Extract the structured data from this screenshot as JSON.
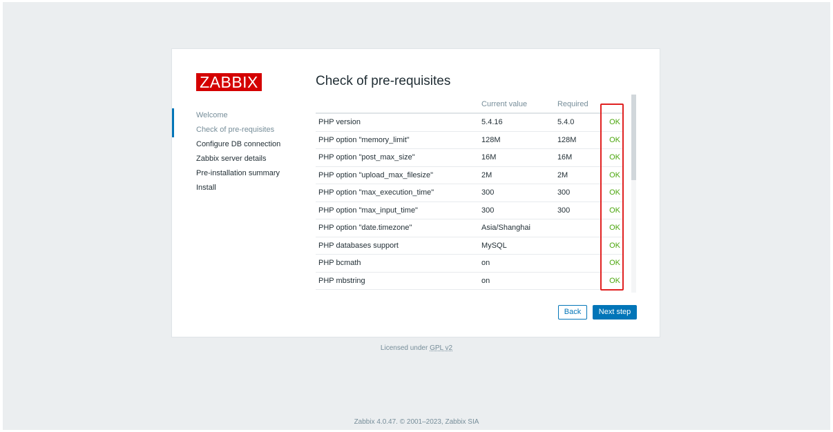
{
  "logo": "ZABBIX",
  "nav": {
    "items": [
      {
        "label": "Welcome",
        "state": "done"
      },
      {
        "label": "Check of pre-requisites",
        "state": "current"
      },
      {
        "label": "Configure DB connection",
        "state": "todo"
      },
      {
        "label": "Zabbix server details",
        "state": "todo"
      },
      {
        "label": "Pre-installation summary",
        "state": "todo"
      },
      {
        "label": "Install",
        "state": "todo"
      }
    ]
  },
  "page_title": "Check of pre-requisites",
  "table": {
    "headers": {
      "name": "",
      "current": "Current value",
      "required": "Required",
      "status": ""
    },
    "rows": [
      {
        "name": "PHP version",
        "current": "5.4.16",
        "required": "5.4.0",
        "status": "OK"
      },
      {
        "name": "PHP option \"memory_limit\"",
        "current": "128M",
        "required": "128M",
        "status": "OK"
      },
      {
        "name": "PHP option \"post_max_size\"",
        "current": "16M",
        "required": "16M",
        "status": "OK"
      },
      {
        "name": "PHP option \"upload_max_filesize\"",
        "current": "2M",
        "required": "2M",
        "status": "OK"
      },
      {
        "name": "PHP option \"max_execution_time\"",
        "current": "300",
        "required": "300",
        "status": "OK"
      },
      {
        "name": "PHP option \"max_input_time\"",
        "current": "300",
        "required": "300",
        "status": "OK"
      },
      {
        "name": "PHP option \"date.timezone\"",
        "current": "Asia/Shanghai",
        "required": "",
        "status": "OK"
      },
      {
        "name": "PHP databases support",
        "current": "MySQL",
        "required": "",
        "status": "OK"
      },
      {
        "name": "PHP bcmath",
        "current": "on",
        "required": "",
        "status": "OK"
      },
      {
        "name": "PHP mbstring",
        "current": "on",
        "required": "",
        "status": "OK"
      }
    ]
  },
  "buttons": {
    "back": "Back",
    "next": "Next step"
  },
  "license": {
    "prefix": "Licensed under ",
    "link": "GPL v2"
  },
  "footer": "Zabbix 4.0.47. © 2001–2023, Zabbix SIA",
  "colors": {
    "accent": "#0275b8",
    "ok": "#4ba60d",
    "logo_bg": "#d40000",
    "highlight": "#e02020"
  }
}
